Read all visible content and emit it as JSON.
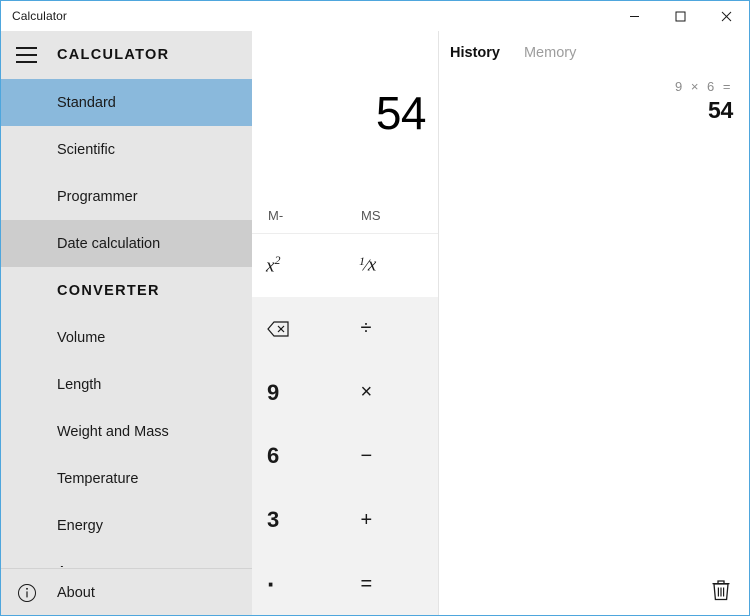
{
  "window": {
    "title": "Calculator",
    "controls": {
      "minimize": "minimize-icon",
      "maximize": "maximize-icon",
      "close": "close-icon"
    },
    "border_color": "#4ea6dd"
  },
  "sidebar": {
    "menu_icon": "hamburger-icon",
    "header_title": "CALCULATOR",
    "calculator_items": [
      {
        "label": "Standard",
        "state": "selected"
      },
      {
        "label": "Scientific",
        "state": "normal"
      },
      {
        "label": "Programmer",
        "state": "normal"
      },
      {
        "label": "Date calculation",
        "state": "hovered"
      }
    ],
    "converter_title": "CONVERTER",
    "converter_items": [
      {
        "label": "Volume",
        "state": "normal"
      },
      {
        "label": "Length",
        "state": "normal"
      },
      {
        "label": "Weight and Mass",
        "state": "normal"
      },
      {
        "label": "Temperature",
        "state": "normal"
      },
      {
        "label": "Energy",
        "state": "normal"
      },
      {
        "label": "Area",
        "state": "clipped"
      }
    ],
    "footer": {
      "icon": "info-icon",
      "label": "About"
    },
    "selected_color": "#8ab9dc",
    "hover_color": "#cdcdcd",
    "background_color": "#e6e6e6"
  },
  "calculator": {
    "display_value": "54",
    "memory_buttons": [
      {
        "label": "M-",
        "name": "memory-subtract-button"
      },
      {
        "label": "MS",
        "name": "memory-store-button"
      }
    ],
    "function_buttons": [
      {
        "label": "x²",
        "name": "square-button"
      },
      {
        "label": "¹⁄x",
        "name": "reciprocal-button"
      }
    ],
    "keypad_rows": [
      [
        {
          "label": "⌫",
          "name": "backspace-button",
          "type": "icon"
        },
        {
          "label": "÷",
          "name": "divide-button",
          "type": "op"
        }
      ],
      [
        {
          "label": "9",
          "name": "digit-9-button",
          "type": "digit"
        },
        {
          "label": "×",
          "name": "multiply-button",
          "type": "op"
        }
      ],
      [
        {
          "label": "6",
          "name": "digit-6-button",
          "type": "digit"
        },
        {
          "label": "−",
          "name": "subtract-button",
          "type": "op"
        }
      ],
      [
        {
          "label": "3",
          "name": "digit-3-button",
          "type": "digit"
        },
        {
          "label": "+",
          "name": "add-button",
          "type": "op"
        }
      ],
      [
        {
          "label": "·",
          "name": "decimal-button",
          "type": "dot"
        },
        {
          "label": "=",
          "name": "equals-button",
          "type": "op"
        }
      ]
    ]
  },
  "history": {
    "tabs": [
      {
        "label": "History",
        "active": true
      },
      {
        "label": "Memory",
        "active": false
      }
    ],
    "entries": [
      {
        "expression": "9  ×  6 =",
        "result": "54"
      }
    ],
    "clear_icon": "trash-icon"
  }
}
